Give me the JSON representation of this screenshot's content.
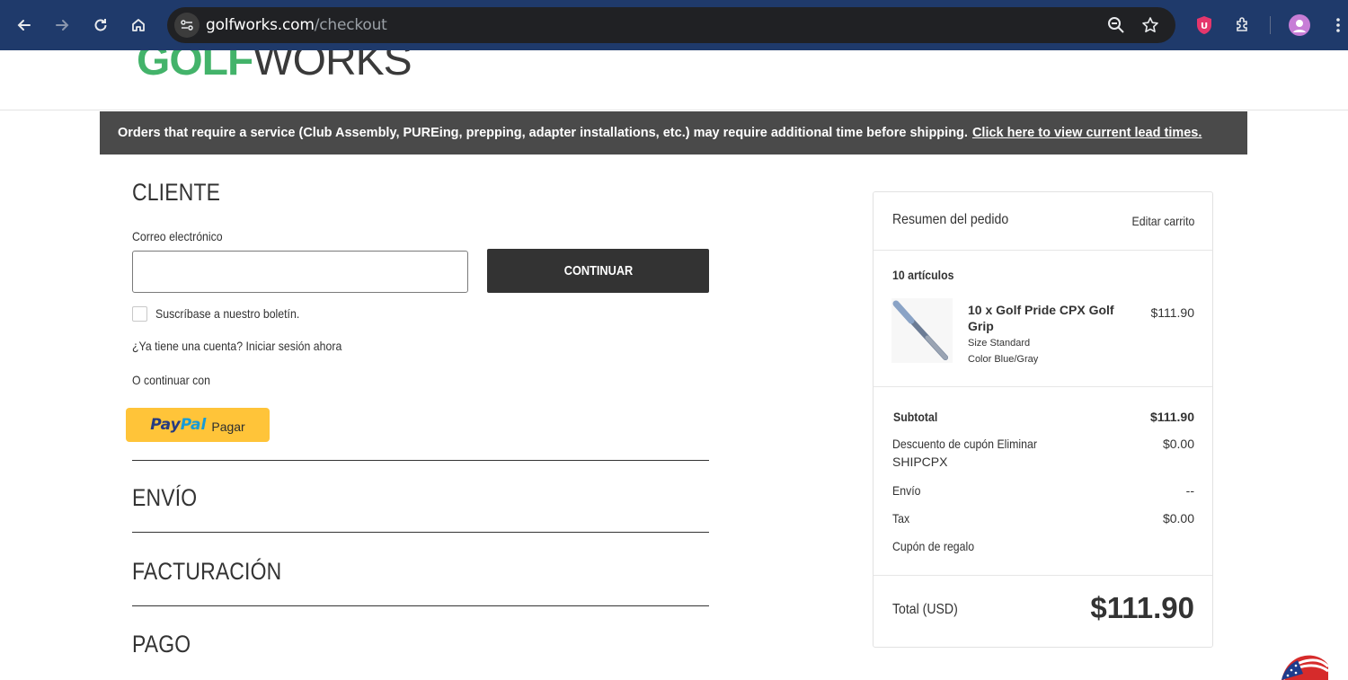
{
  "browser": {
    "url_domain": "golfworks.com",
    "url_path": "/checkout"
  },
  "header": {
    "logo_part1": "GOLF",
    "logo_part2": "WORKS"
  },
  "banner": {
    "text": "Orders that require a service (Club Assembly, PUREing, prepping, adapter installations, etc.) may require additional time before shipping.",
    "link": "Click here to view current lead times."
  },
  "customer": {
    "title": "CLIENTE",
    "email_label": "Correo electrónico",
    "email_value": "",
    "continue_label": "CONTINUAR",
    "newsletter_label": "Suscríbase a nuestro boletín.",
    "account_text": "¿Ya tiene una cuenta? Iniciar sesión ahora",
    "or_continue": "O continuar con",
    "paypal_part1": "Pay",
    "paypal_part2": "Pal",
    "paypal_pay": "Pagar"
  },
  "steps": {
    "shipping": "ENVÍO",
    "billing": "FACTURACIÓN",
    "payment": "PAGO"
  },
  "summary": {
    "title": "Resumen del pedido",
    "edit_cart": "Editar carrito",
    "items_count": "10 artículos",
    "item": {
      "name": "10 x Golf Pride CPX Golf Grip",
      "size": "Size Standard",
      "color": "Color Blue/Gray",
      "price": "$111.90"
    },
    "subtotal_label": "Subtotal",
    "subtotal_value": "$111.90",
    "coupon_label": "Descuento de cupón Eliminar",
    "coupon_code": "SHIPCPX",
    "coupon_value": "$0.00",
    "shipping_label": "Envío",
    "shipping_value": "--",
    "tax_label": "Tax",
    "tax_value": "$0.00",
    "gift_label": "Cupón de regalo",
    "total_label": "Total (USD)",
    "total_value": "$111.90"
  },
  "colors": {
    "chrome": "#1f3a6b",
    "banner": "#4a4a4a",
    "button": "#333333",
    "paypal": "#ffc439",
    "logo_green": "#43b36a"
  }
}
